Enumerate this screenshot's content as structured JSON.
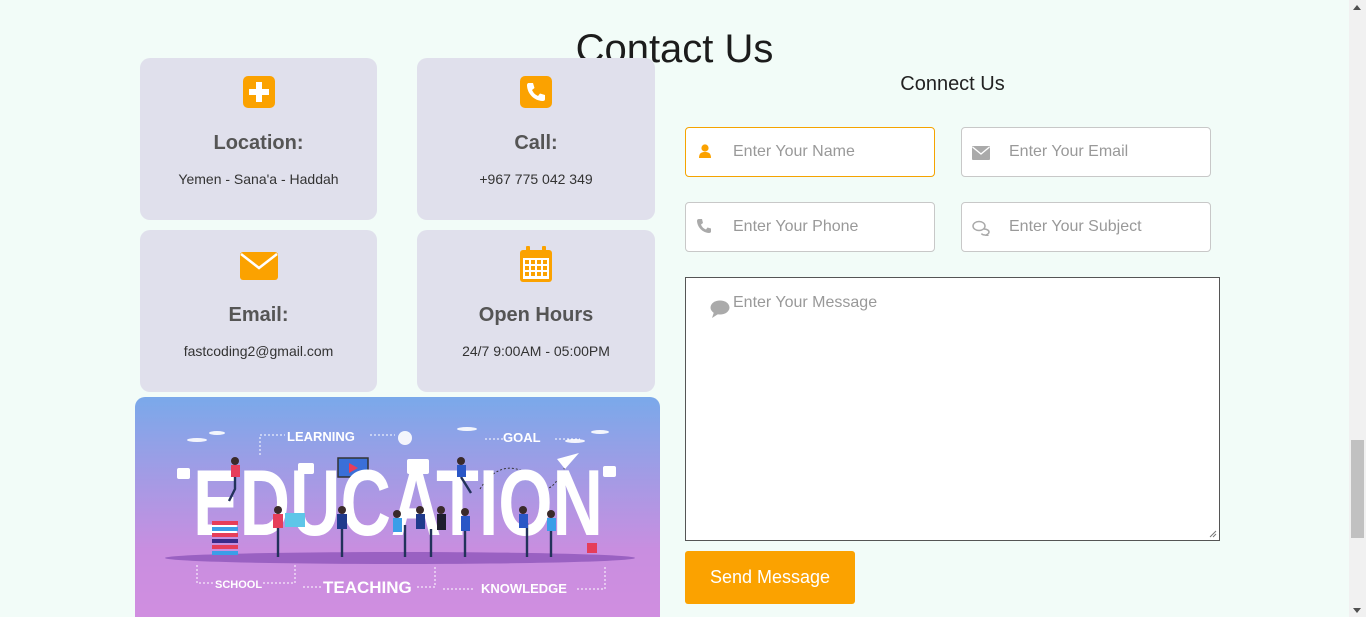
{
  "title": "Contact Us",
  "cards": [
    {
      "title": "Location:",
      "text": "Yemen - Sana'a - Haddah",
      "icon": "plus-square-icon"
    },
    {
      "title": "Call:",
      "text": "+967 775 042 349",
      "icon": "phone-icon"
    },
    {
      "title": "Email:",
      "text": "fastcoding2@gmail.com",
      "icon": "envelope-icon"
    },
    {
      "title": "Open Hours",
      "text": "24/7 9:00AM - 05:00PM",
      "icon": "calendar-icon"
    }
  ],
  "illustration": {
    "word": "EDUCATION",
    "labels": {
      "learning": "LEARNING",
      "goal": "GOAL",
      "school": "SCHOOL",
      "teaching": "TEACHING",
      "knowledge": "KNOWLEDGE"
    }
  },
  "form": {
    "heading": "Connect Us",
    "name_placeholder": "Enter Your Name",
    "email_placeholder": "Enter Your Email",
    "phone_placeholder": "Enter Your Phone",
    "subject_placeholder": "Enter Your Subject",
    "message_placeholder": "Enter Your Message",
    "send_label": "Send Message"
  },
  "colors": {
    "accent": "#fba200",
    "card_bg": "#e0e0ec",
    "page_bg": "#f2fcf8"
  }
}
